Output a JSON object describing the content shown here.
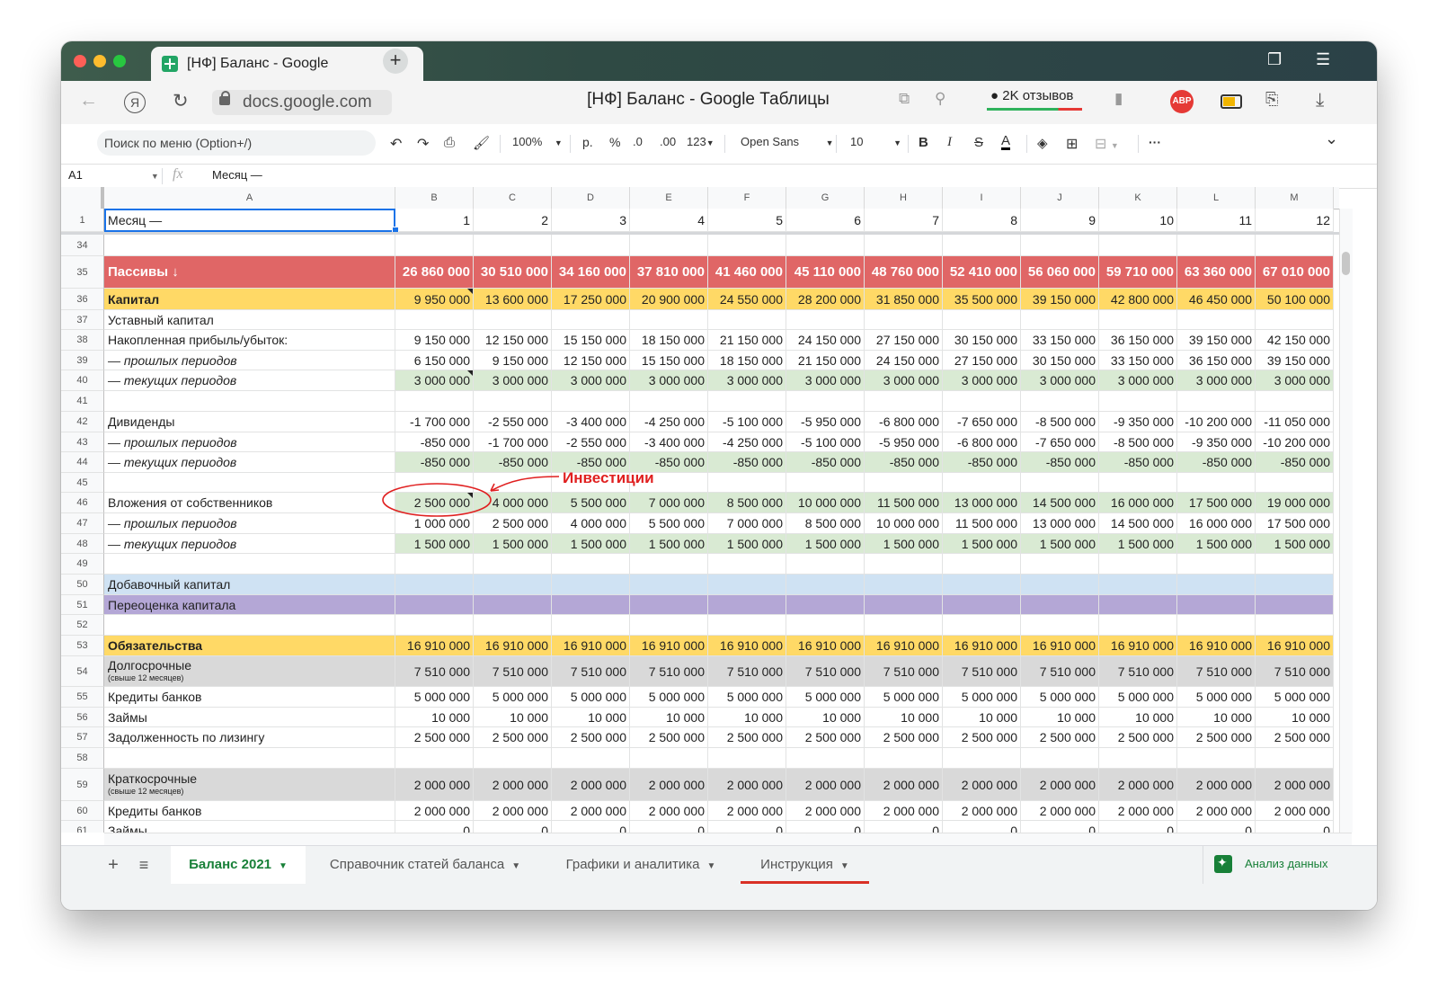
{
  "browser": {
    "tab_title": "[НФ] Баланс - Google",
    "tab_close": "×",
    "new_tab": "+",
    "url": "docs.google.com",
    "page_title": "[НФ] Баланс - Google Таблицы",
    "reviews": "2K отзывов",
    "abp": "ABP"
  },
  "toolbar": {
    "menu_search": "Поиск по меню (Option+/)",
    "zoom": "100%",
    "currency": "р.",
    "percent": "%",
    "dec_less": ".0",
    "dec_more": ".00",
    "format_123": "123",
    "font": "Open Sans",
    "font_size": "10",
    "bold": "B",
    "italic": "I",
    "strike": "S",
    "text_color": "A",
    "more": "···",
    "collapse": "⌄"
  },
  "formula_bar": {
    "cell_ref": "A1",
    "fx": "fx",
    "value": "Месяц —"
  },
  "columns": [
    "A",
    "B",
    "C",
    "D",
    "E",
    "F",
    "G",
    "H",
    "I",
    "J",
    "K",
    "L",
    "M"
  ],
  "header_row": {
    "num": "1",
    "label": "Месяц —",
    "values": [
      "1",
      "2",
      "3",
      "4",
      "5",
      "6",
      "7",
      "8",
      "9",
      "10",
      "11",
      "12"
    ]
  },
  "rows": [
    {
      "num": "34",
      "label": "",
      "values": [],
      "style": "plain",
      "h": 24
    },
    {
      "num": "35",
      "label": "Пассивы ↓",
      "values": [
        "26 860 000",
        "30 510 000",
        "34 160 000",
        "37 810 000",
        "41 460 000",
        "45 110 000",
        "48 760 000",
        "52 410 000",
        "56 060 000",
        "59 710 000",
        "63 360 000",
        "67 010 000"
      ],
      "style": "red",
      "h": 36
    },
    {
      "num": "36",
      "label": "Капитал",
      "values": [
        "9 950 000",
        "13 600 000",
        "17 250 000",
        "20 900 000",
        "24 550 000",
        "28 200 000",
        "31 850 000",
        "35 500 000",
        "39 150 000",
        "42 800 000",
        "46 450 000",
        "50 100 000"
      ],
      "style": "yellow",
      "h": 24,
      "note": true
    },
    {
      "num": "37",
      "label": "Уставный капитал",
      "values": [],
      "style": "plain",
      "h": 22
    },
    {
      "num": "38",
      "label": "Накопленная прибыль/убыток:",
      "values": [
        "9 150 000",
        "12 150 000",
        "15 150 000",
        "18 150 000",
        "21 150 000",
        "24 150 000",
        "27 150 000",
        "30 150 000",
        "33 150 000",
        "36 150 000",
        "39 150 000",
        "42 150 000"
      ],
      "style": "plain",
      "h": 23
    },
    {
      "num": "39",
      "label": "— прошлых периодов",
      "values": [
        "6 150 000",
        "9 150 000",
        "12 150 000",
        "15 150 000",
        "18 150 000",
        "21 150 000",
        "24 150 000",
        "27 150 000",
        "30 150 000",
        "33 150 000",
        "36 150 000",
        "39 150 000"
      ],
      "style": "plain-italic",
      "h": 22
    },
    {
      "num": "40",
      "label": "— текущих периодов",
      "values": [
        "3 000 000",
        "3 000 000",
        "3 000 000",
        "3 000 000",
        "3 000 000",
        "3 000 000",
        "3 000 000",
        "3 000 000",
        "3 000 000",
        "3 000 000",
        "3 000 000",
        "3 000 000"
      ],
      "style": "green-italic",
      "h": 23,
      "note": true
    },
    {
      "num": "41",
      "label": "",
      "values": [],
      "style": "plain",
      "h": 23
    },
    {
      "num": "42",
      "label": "Дивиденды",
      "values": [
        "-1 700 000",
        "-2 550 000",
        "-3 400 000",
        "-4 250 000",
        "-5 100 000",
        "-5 950 000",
        "-6 800 000",
        "-7 650 000",
        "-8 500 000",
        "-9 350 000",
        "-10 200 000",
        "-11 050 000"
      ],
      "style": "plain",
      "h": 23
    },
    {
      "num": "43",
      "label": "— прошлых периодов",
      "values": [
        "-850 000",
        "-1 700 000",
        "-2 550 000",
        "-3 400 000",
        "-4 250 000",
        "-5 100 000",
        "-5 950 000",
        "-6 800 000",
        "-7 650 000",
        "-8 500 000",
        "-9 350 000",
        "-10 200 000"
      ],
      "style": "plain-italic",
      "h": 22
    },
    {
      "num": "44",
      "label": "— текущих периодов",
      "values": [
        "-850 000",
        "-850 000",
        "-850 000",
        "-850 000",
        "-850 000",
        "-850 000",
        "-850 000",
        "-850 000",
        "-850 000",
        "-850 000",
        "-850 000",
        "-850 000"
      ],
      "style": "green-italic",
      "h": 23
    },
    {
      "num": "45",
      "label": "",
      "values": [],
      "style": "plain",
      "h": 22
    },
    {
      "num": "46",
      "label": "Вложения от собственников",
      "values": [
        "2 500 000",
        "4 000 000",
        "5 500 000",
        "7 000 000",
        "8 500 000",
        "10 000 000",
        "11 500 000",
        "13 000 000",
        "14 500 000",
        "16 000 000",
        "17 500 000",
        "19 000 000"
      ],
      "style": "green",
      "h": 23,
      "note": true
    },
    {
      "num": "47",
      "label": "— прошлых периодов",
      "values": [
        "1 000 000",
        "2 500 000",
        "4 000 000",
        "5 500 000",
        "7 000 000",
        "8 500 000",
        "10 000 000",
        "11 500 000",
        "13 000 000",
        "14 500 000",
        "16 000 000",
        "17 500 000"
      ],
      "style": "plain-italic",
      "h": 23
    },
    {
      "num": "48",
      "label": "— текущих периодов",
      "values": [
        "1 500 000",
        "1 500 000",
        "1 500 000",
        "1 500 000",
        "1 500 000",
        "1 500 000",
        "1 500 000",
        "1 500 000",
        "1 500 000",
        "1 500 000",
        "1 500 000",
        "1 500 000"
      ],
      "style": "green-italic",
      "h": 22
    },
    {
      "num": "49",
      "label": "",
      "values": [],
      "style": "plain",
      "h": 23
    },
    {
      "num": "50",
      "label": "Добавочный капитал",
      "values": [],
      "style": "blue",
      "h": 23
    },
    {
      "num": "51",
      "label": "Переоценка капитала",
      "values": [],
      "style": "purple",
      "h": 22
    },
    {
      "num": "52",
      "label": "",
      "values": [],
      "style": "plain",
      "h": 23
    },
    {
      "num": "53",
      "label": "Обязательства",
      "values": [
        "16 910 000",
        "16 910 000",
        "16 910 000",
        "16 910 000",
        "16 910 000",
        "16 910 000",
        "16 910 000",
        "16 910 000",
        "16 910 000",
        "16 910 000",
        "16 910 000",
        "16 910 000"
      ],
      "style": "yellow",
      "h": 23
    },
    {
      "num": "54",
      "label": "Долгосрочные",
      "sub": "(свыше 12 месяцев)",
      "values": [
        "7 510 000",
        "7 510 000",
        "7 510 000",
        "7 510 000",
        "7 510 000",
        "7 510 000",
        "7 510 000",
        "7 510 000",
        "7 510 000",
        "7 510 000",
        "7 510 000",
        "7 510 000"
      ],
      "style": "gray",
      "h": 34
    },
    {
      "num": "55",
      "label": "Кредиты банков",
      "values": [
        "5 000 000",
        "5 000 000",
        "5 000 000",
        "5 000 000",
        "5 000 000",
        "5 000 000",
        "5 000 000",
        "5 000 000",
        "5 000 000",
        "5 000 000",
        "5 000 000",
        "5 000 000"
      ],
      "style": "plain",
      "h": 23
    },
    {
      "num": "56",
      "label": "Займы",
      "values": [
        "10 000",
        "10 000",
        "10 000",
        "10 000",
        "10 000",
        "10 000",
        "10 000",
        "10 000",
        "10 000",
        "10 000",
        "10 000",
        "10 000"
      ],
      "style": "plain",
      "h": 22
    },
    {
      "num": "57",
      "label": "Задолженность по лизингу",
      "values": [
        "2 500 000",
        "2 500 000",
        "2 500 000",
        "2 500 000",
        "2 500 000",
        "2 500 000",
        "2 500 000",
        "2 500 000",
        "2 500 000",
        "2 500 000",
        "2 500 000",
        "2 500 000"
      ],
      "style": "plain",
      "h": 23
    },
    {
      "num": "58",
      "label": "",
      "values": [],
      "style": "plain",
      "h": 23
    },
    {
      "num": "59",
      "label": "Краткосрочные",
      "sub": "(свыше 12 месяцев)",
      "values": [
        "2 000 000",
        "2 000 000",
        "2 000 000",
        "2 000 000",
        "2 000 000",
        "2 000 000",
        "2 000 000",
        "2 000 000",
        "2 000 000",
        "2 000 000",
        "2 000 000",
        "2 000 000"
      ],
      "style": "gray",
      "h": 36
    },
    {
      "num": "60",
      "label": "Кредиты банков",
      "values": [
        "2 000 000",
        "2 000 000",
        "2 000 000",
        "2 000 000",
        "2 000 000",
        "2 000 000",
        "2 000 000",
        "2 000 000",
        "2 000 000",
        "2 000 000",
        "2 000 000",
        "2 000 000"
      ],
      "style": "plain",
      "h": 22
    },
    {
      "num": "61",
      "label": "Займы",
      "values": [
        "0",
        "0",
        "0",
        "0",
        "0",
        "0",
        "0",
        "0",
        "0",
        "0",
        "0",
        "0"
      ],
      "style": "plain",
      "h": 23
    }
  ],
  "annotation": {
    "text": "Инвестиции",
    "color": "#e02020"
  },
  "sheet_tabs": {
    "add": "+",
    "list": "≡",
    "tabs": [
      {
        "label": "Баланс 2021",
        "active": true
      },
      {
        "label": "Справочник статей баланса",
        "active": false
      },
      {
        "label": "Графики и аналитика",
        "active": false
      },
      {
        "label": "Инструкция",
        "active": false
      }
    ],
    "explore": "Анализ данных"
  },
  "colors": {
    "red": "#e06666",
    "yellow": "#ffd966",
    "green": "#d9ead3",
    "blue": "#cfe2f3",
    "purple": "#b4a7d6",
    "gray": "#d9d9d9",
    "accent_green": "#188038"
  }
}
